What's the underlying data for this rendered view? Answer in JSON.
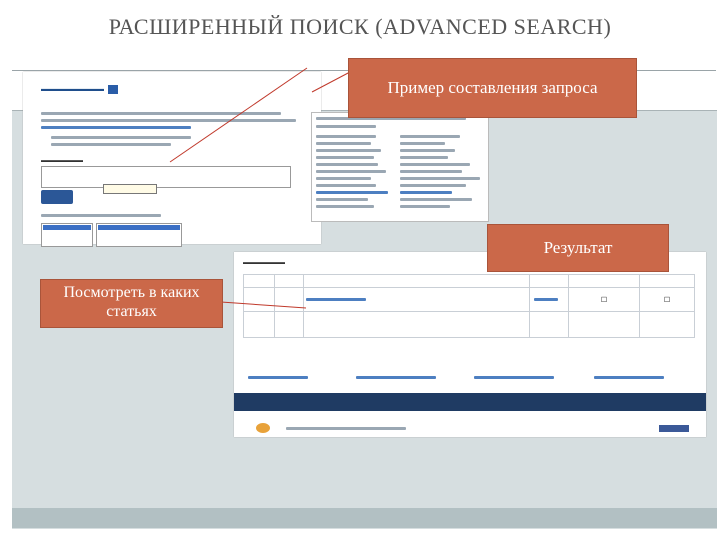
{
  "slide": {
    "title": "РАСШИРЕННЫЙ ПОИСК (ADVANCED SEARCH)"
  },
  "callouts": {
    "query_example": "Пример составления запроса",
    "result": "Результат",
    "see_articles": "Посмотреть в каких статьях"
  },
  "colors": {
    "callout": "#cb6849",
    "stage": "#d6dee0",
    "link_blue": "#2b5797",
    "navbar": "#1f3b63"
  }
}
